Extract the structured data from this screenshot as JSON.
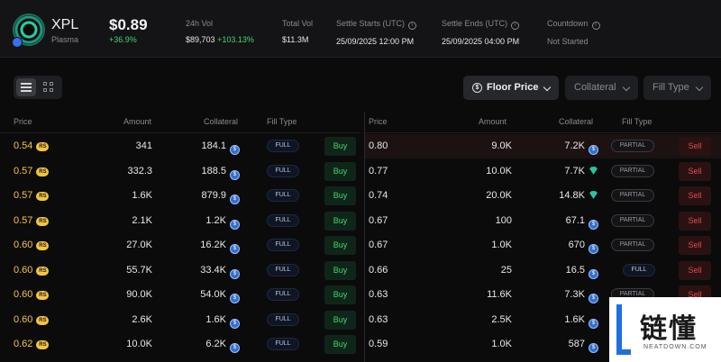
{
  "header": {
    "token_symbol": "XPL",
    "token_network": "Plasma",
    "price": "$0.89",
    "price_change": "+36.9%",
    "stats": [
      {
        "label": "24h Vol",
        "value": "$89,703",
        "extra": "+103.13%"
      },
      {
        "label": "Total Vol",
        "value": "$11.3M"
      },
      {
        "label": "Settle Starts (UTC)",
        "value": "25/09/2025 12:00 PM"
      },
      {
        "label": "Settle Ends (UTC)",
        "value": "25/09/2025 04:00 PM"
      },
      {
        "label": "Countdown",
        "value": "Not Started"
      }
    ]
  },
  "toolbar": {
    "floor_price": "Floor Price",
    "collateral": "Collateral",
    "fill_type": "Fill Type"
  },
  "buy_table": {
    "headers": {
      "price": "Price",
      "amount": "Amount",
      "collateral": "Collateral",
      "fill_type": "Fill Type"
    },
    "rows": [
      {
        "price": "0.54",
        "amount": "341",
        "collateral": "184.1",
        "fill": "FULL",
        "action": "Buy"
      },
      {
        "price": "0.57",
        "amount": "332.3",
        "collateral": "188.5",
        "fill": "FULL",
        "action": "Buy"
      },
      {
        "price": "0.57",
        "amount": "1.6K",
        "collateral": "879.9",
        "fill": "FULL",
        "action": "Buy"
      },
      {
        "price": "0.57",
        "amount": "2.1K",
        "collateral": "1.2K",
        "fill": "FULL",
        "action": "Buy"
      },
      {
        "price": "0.60",
        "amount": "27.0K",
        "collateral": "16.2K",
        "fill": "FULL",
        "action": "Buy"
      },
      {
        "price": "0.60",
        "amount": "55.7K",
        "collateral": "33.4K",
        "fill": "FULL",
        "action": "Buy"
      },
      {
        "price": "0.60",
        "amount": "90.0K",
        "collateral": "54.0K",
        "fill": "FULL",
        "action": "Buy"
      },
      {
        "price": "0.60",
        "amount": "2.6K",
        "collateral": "1.6K",
        "fill": "FULL",
        "action": "Buy"
      },
      {
        "price": "0.62",
        "amount": "10.0K",
        "collateral": "6.2K",
        "fill": "FULL",
        "action": "Buy"
      }
    ]
  },
  "sell_table": {
    "headers": {
      "price": "Price",
      "amount": "Amount",
      "collateral": "Collateral",
      "fill_type": "Fill Type"
    },
    "rows": [
      {
        "price": "0.80",
        "amount": "9.0K",
        "collateral": "7.2K",
        "coin": "usdc",
        "fill": "PARTIAL",
        "action": "Sell"
      },
      {
        "price": "0.77",
        "amount": "10.0K",
        "collateral": "7.7K",
        "coin": "usdt",
        "fill": "PARTIAL",
        "action": "Sell"
      },
      {
        "price": "0.74",
        "amount": "20.0K",
        "collateral": "14.8K",
        "coin": "usdt",
        "fill": "PARTIAL",
        "action": "Sell"
      },
      {
        "price": "0.67",
        "amount": "100",
        "collateral": "67.1",
        "coin": "usdc",
        "fill": "PARTIAL",
        "action": "Sell"
      },
      {
        "price": "0.67",
        "amount": "1.0K",
        "collateral": "670",
        "coin": "usdc",
        "fill": "PARTIAL",
        "action": "Sell"
      },
      {
        "price": "0.66",
        "amount": "25",
        "collateral": "16.5",
        "coin": "usdc",
        "fill": "FULL",
        "action": "Sell"
      },
      {
        "price": "0.63",
        "amount": "11.6K",
        "collateral": "7.3K",
        "coin": "usdc",
        "fill": "PARTIAL",
        "action": "Sell"
      },
      {
        "price": "0.63",
        "amount": "2.5K",
        "collateral": "1.6K",
        "coin": "usdc",
        "fill": "",
        "action": ""
      },
      {
        "price": "0.59",
        "amount": "1.0K",
        "collateral": "587",
        "coin": "usdc",
        "fill": "",
        "action": ""
      }
    ]
  },
  "price_badge": "RS",
  "watermark": {
    "cn": "链懂",
    "en": "NEATDOWN.COM"
  },
  "colors": {
    "accent_buy": "#3fd66b",
    "accent_sell": "#e24a4a",
    "price_yellow": "#f4c441",
    "usdc_blue": "#2f6fd6",
    "usdt_green": "#26c6a0"
  }
}
